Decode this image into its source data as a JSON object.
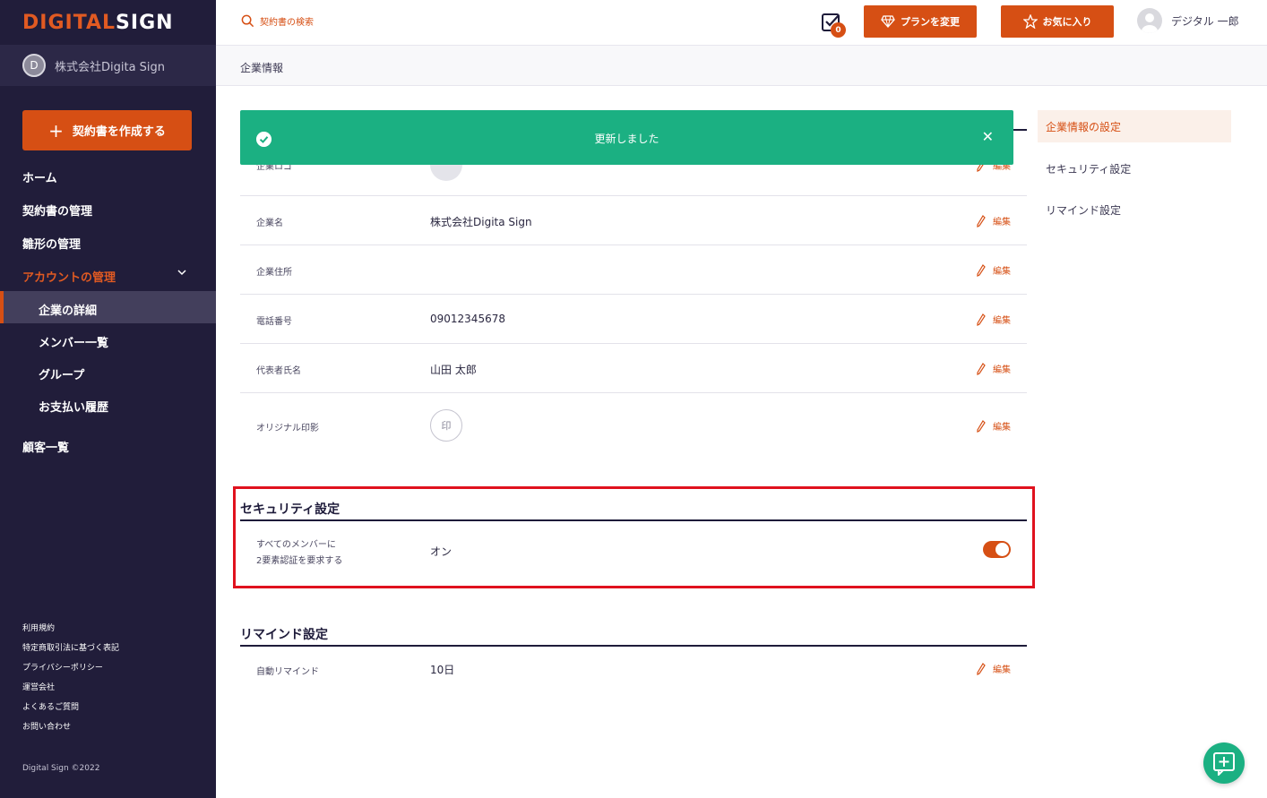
{
  "logo": {
    "part1": "DIGITAL",
    "part2": "SIGN"
  },
  "company": {
    "initial": "D",
    "name": "株式会社Digita Sign"
  },
  "sidebar": {
    "create_label": "契約書を作成する",
    "items": [
      {
        "label": "ホーム"
      },
      {
        "label": "契約書の管理"
      },
      {
        "label": "雛形の管理"
      },
      {
        "label": "アカウントの管理"
      }
    ],
    "sub_items": [
      {
        "label": "企業の詳細"
      },
      {
        "label": "メンバー一覧"
      },
      {
        "label": "グループ"
      },
      {
        "label": "お支払い履歴"
      }
    ],
    "customers": "顧客一覧",
    "footer_links": [
      "利用規約",
      "特定商取引法に基づく表記",
      "プライバシーポリシー",
      "運営会社",
      "よくあるご質問",
      "お問い合わせ"
    ],
    "copyright": "Digital Sign ©2022"
  },
  "header": {
    "search_placeholder": "契約書の検索",
    "task_count": "0",
    "plan_button": "プランを変更",
    "favorite_button": "お気に入り",
    "user_name": "デジタル 一郎"
  },
  "page": {
    "title": "企業情報"
  },
  "toast": {
    "message": "更新しました"
  },
  "company_info": {
    "edit_label": "編集",
    "rows": [
      {
        "label": "企業ロゴ",
        "value": ""
      },
      {
        "label": "企業名",
        "value": "株式会社Digita Sign"
      },
      {
        "label": "企業住所",
        "value": ""
      },
      {
        "label": "電話番号",
        "value": "09012345678"
      },
      {
        "label": "代表者氏名",
        "value": "山田 太郎"
      },
      {
        "label": "オリジナル印影",
        "value": "印"
      }
    ]
  },
  "security": {
    "title": "セキュリティ設定",
    "label_line1": "すべてのメンバーに",
    "label_line2": "2要素認証を要求する",
    "value": "オン",
    "enabled": true
  },
  "remind": {
    "title": "リマインド設定",
    "label": "自動リマインド",
    "value": "10日"
  },
  "right_nav": [
    {
      "label": "企業情報の設定"
    },
    {
      "label": "セキュリティ設定"
    },
    {
      "label": "リマインド設定"
    }
  ],
  "colors": {
    "accent": "#d64f14",
    "sidebar": "#211d3a",
    "success": "#1bb082",
    "highlight": "#e0121e"
  }
}
